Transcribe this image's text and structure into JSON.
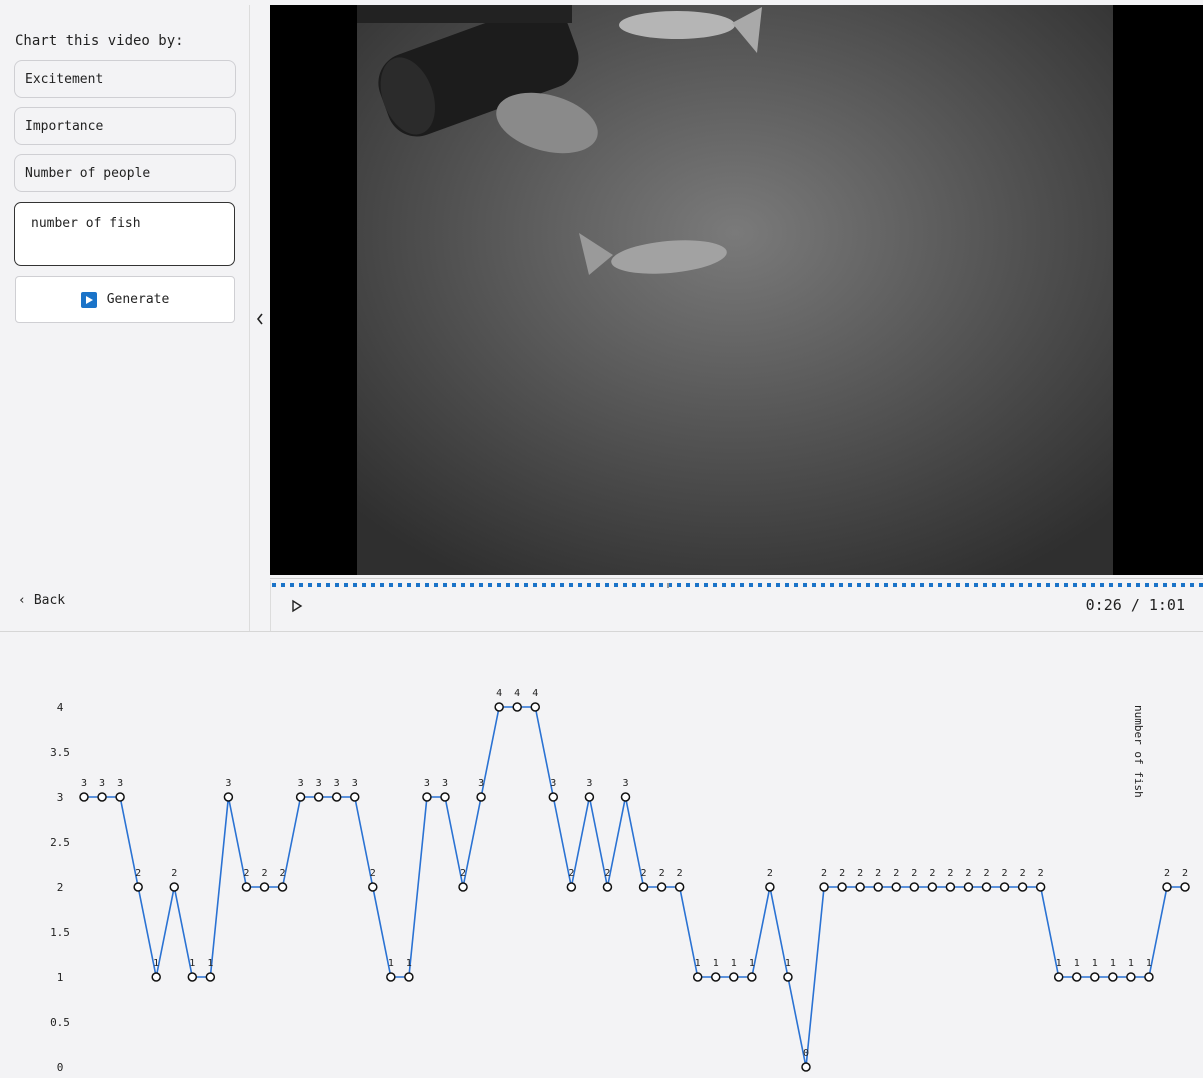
{
  "sidebar": {
    "title": "Chart this video by:",
    "options": [
      "Excitement",
      "Importance",
      "Number of people"
    ],
    "custom_value": "number of fish",
    "generate_label": "Generate",
    "back_label": "Back"
  },
  "player": {
    "current_time": "0:26",
    "separator": "/",
    "duration": "1:01",
    "progress": 0.426
  },
  "colors": {
    "accent": "#1a73c8",
    "line": "#2a72d3"
  },
  "chart_data": {
    "type": "line",
    "ylabel": "number of fish",
    "yticks": [
      "0",
      "0.5",
      "1",
      "1.5",
      "2",
      "2.5",
      "3",
      "3.5",
      "4"
    ],
    "ylim": [
      0,
      4
    ],
    "grid": false,
    "values": [
      3,
      3,
      3,
      2,
      1,
      2,
      1,
      1,
      3,
      2,
      2,
      2,
      3,
      3,
      3,
      3,
      2,
      1,
      1,
      3,
      3,
      2,
      3,
      4,
      4,
      4,
      3,
      2,
      3,
      2,
      3,
      2,
      2,
      2,
      1,
      1,
      1,
      1,
      2,
      1,
      0,
      2,
      2,
      2,
      2,
      2,
      2,
      2,
      2,
      2,
      2,
      2,
      2,
      2,
      1,
      1,
      1,
      1,
      1,
      1,
      2,
      2
    ]
  }
}
